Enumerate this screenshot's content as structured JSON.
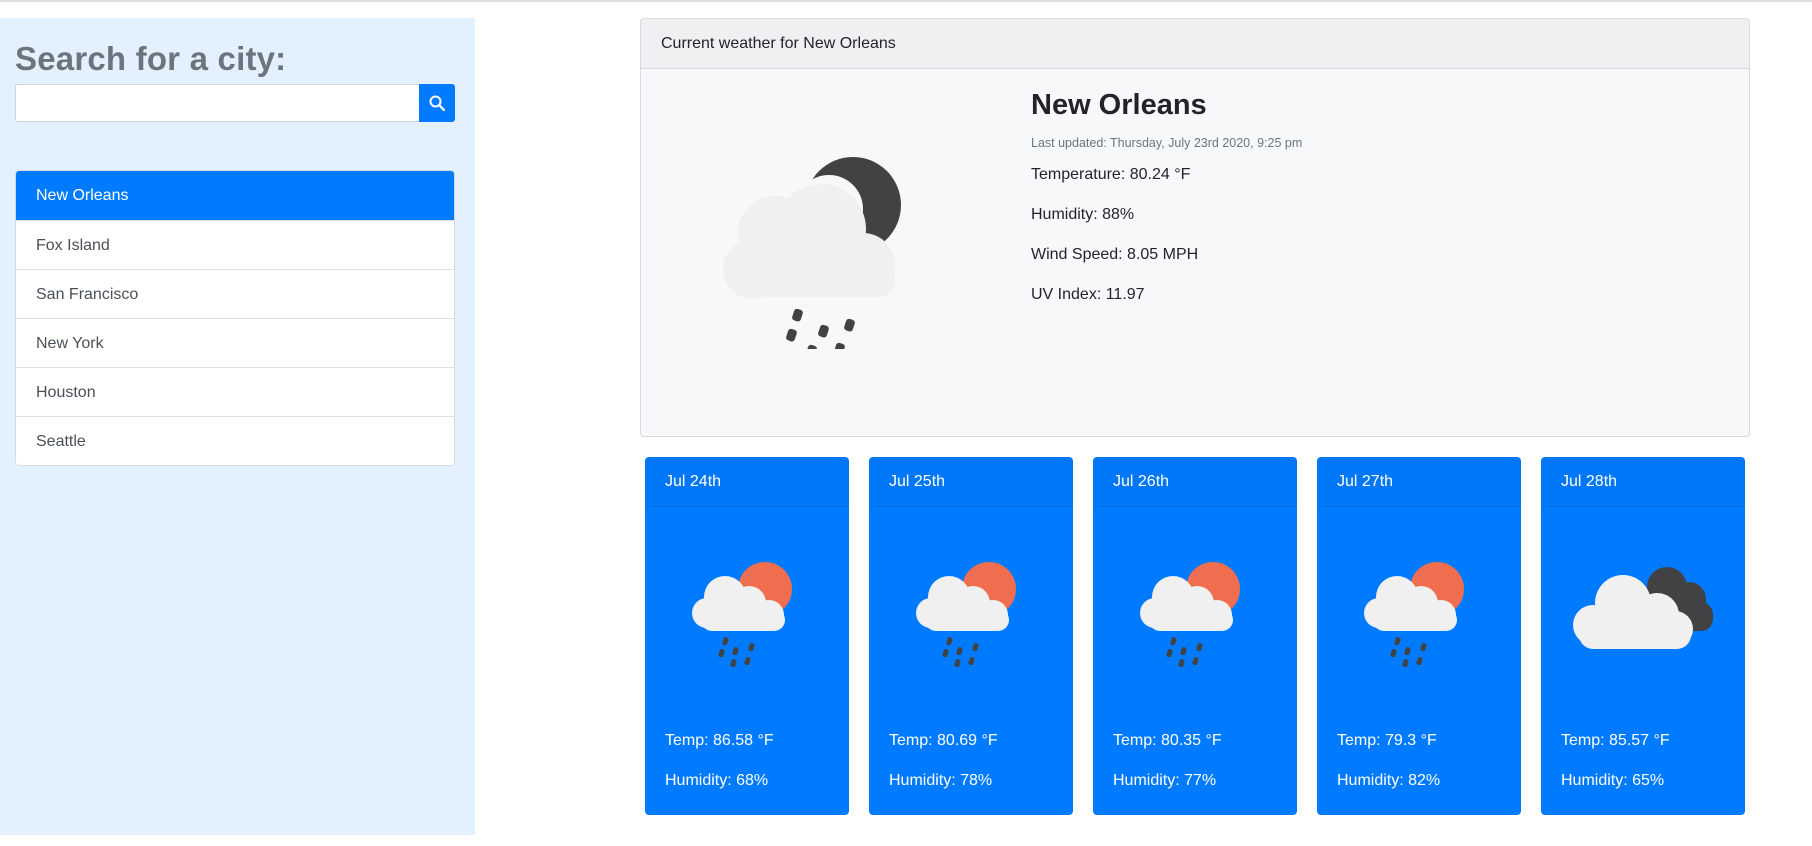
{
  "sidebar": {
    "title": "Search for a city:",
    "search_value": "",
    "search_placeholder": "",
    "cities": [
      "New Orleans",
      "Fox Island",
      "San Francisco",
      "New York",
      "Houston",
      "Seattle"
    ],
    "active_city": "New Orleans"
  },
  "current": {
    "header": "Current weather for New Orleans",
    "city": "New Orleans",
    "updated": "Last updated: Thursday, July 23rd 2020, 9:25 pm",
    "temperature": "Temperature: 80.24 °F",
    "humidity": "Humidity: 88%",
    "wind": "Wind Speed: 8.05 MPH",
    "uv": "UV Index: 11.97",
    "icon": "night-rain-icon"
  },
  "forecast": [
    {
      "date": "Jul 24th",
      "temp": "Temp: 86.58 °F",
      "humidity": "Humidity: 68%",
      "icon": "sun-rain-icon"
    },
    {
      "date": "Jul 25th",
      "temp": "Temp: 80.69 °F",
      "humidity": "Humidity: 78%",
      "icon": "sun-rain-icon"
    },
    {
      "date": "Jul 26th",
      "temp": "Temp: 80.35 °F",
      "humidity": "Humidity: 77%",
      "icon": "sun-rain-icon"
    },
    {
      "date": "Jul 27th",
      "temp": "Temp: 79.3 °F",
      "humidity": "Humidity: 82%",
      "icon": "sun-rain-icon"
    },
    {
      "date": "Jul 28th",
      "temp": "Temp: 85.57 °F",
      "humidity": "Humidity: 65%",
      "icon": "clouds-icon"
    }
  ],
  "colors": {
    "accent": "#007bff",
    "sidebar_bg": "#e3f0fd",
    "sun": "#ee6e4f",
    "moon": "#424244",
    "cloud": "#f0f0f0"
  }
}
